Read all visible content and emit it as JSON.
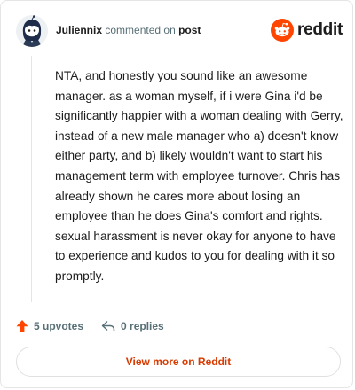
{
  "header": {
    "username": "Juliennix",
    "action_text": "commented on",
    "target_text": "post",
    "brand_name": "reddit"
  },
  "comment": {
    "body": "NTA, and honestly you sound like an awesome manager. as a woman myself, if i were Gina i'd be significantly happier with a woman dealing with Gerry, instead of a new male manager who a) doesn't know either party, and b) likely wouldn't want to start his management term with employee turnover. Chris has already shown he cares more about losing an employee than he does Gina's comfort and rights. sexual harassment is never okay for anyone to have to experience and kudos to you for dealing with it so promptly."
  },
  "actions": {
    "upvotes_label": "5 upvotes",
    "replies_label": "0 replies"
  },
  "footer": {
    "view_more_label": "View more on Reddit"
  },
  "colors": {
    "brand_orange": "#ff4500",
    "link_orange": "#d93a00",
    "muted": "#576f76"
  },
  "icons": {
    "avatar": "snoo-avatar-icon",
    "brand": "reddit-logo-icon",
    "upvote": "upvote-arrow-icon",
    "reply": "reply-arrow-icon"
  }
}
